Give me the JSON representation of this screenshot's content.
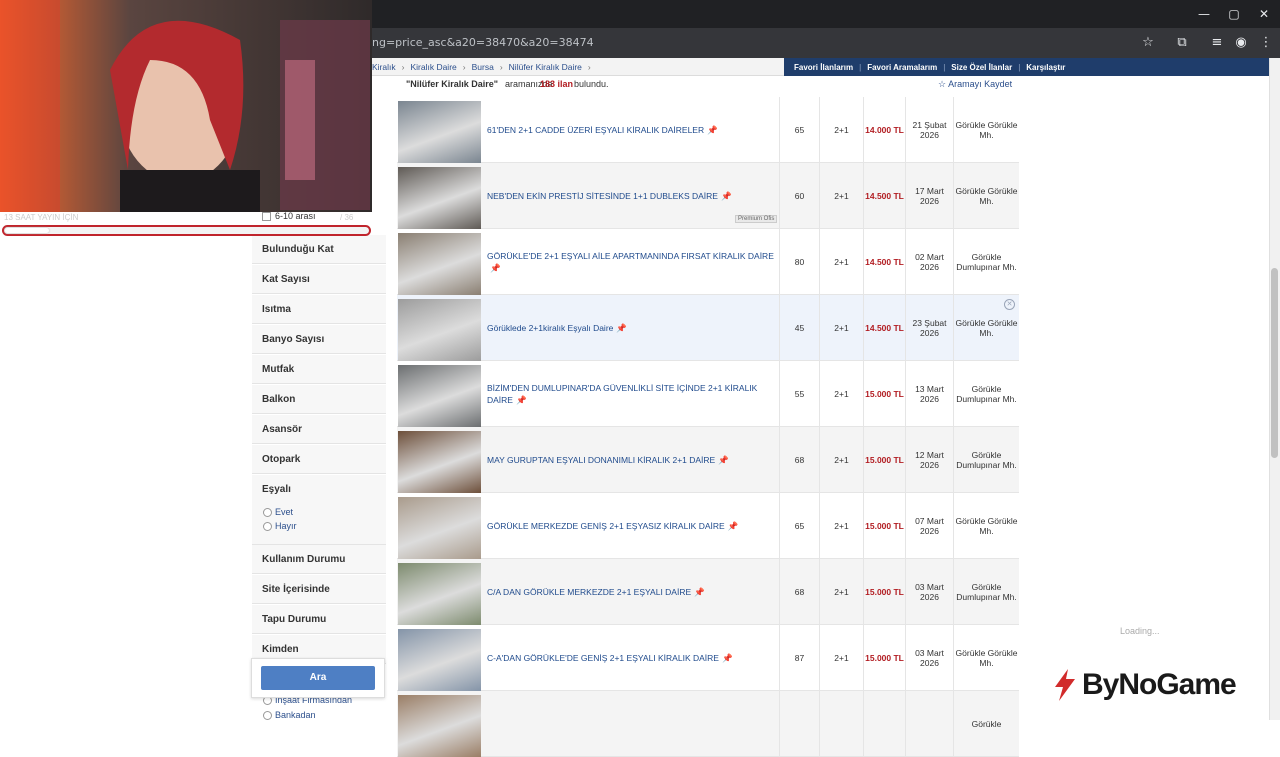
{
  "browser": {
    "url": "ng=price_asc&a20=38470&a20=38474",
    "window_buttons": [
      "—",
      "▢",
      "✕"
    ],
    "toolbar_icons": [
      "star-icon",
      "extensions-icon",
      "media-icon",
      "profile-icon",
      "menu-icon"
    ]
  },
  "breadcrumb": [
    "Kiralık",
    "Kiralık Daire",
    "Bursa",
    "Nilüfer Kiralık Daire"
  ],
  "top_nav": [
    "Favori İlanlarım",
    "Favori Aramalarım",
    "Size Özel İlanlar",
    "Karşılaştır"
  ],
  "results": {
    "query": "\"Nilüfer Kiralık Daire\"",
    "middle": "aramanızda",
    "count": "183 ilan",
    "suffix": "bulundu.",
    "save_label": "Aramayı Kaydet"
  },
  "listings": [
    {
      "title": "61'DEN 2+1 CADDE ÜZERİ EŞYALI KİRALIK DAİRELER",
      "m2": "65",
      "rooms": "2+1",
      "price": "14.000 TL",
      "date": "21 Şubat 2026",
      "location": "Görükle Görükle Mh.",
      "thumb": "#7a8590"
    },
    {
      "title": "NEB'DEN EKİN PRESTİJ SİTESİNDE 1+1 DUBLEKS DAİRE",
      "m2": "60",
      "rooms": "2+1",
      "price": "14.500 TL",
      "date": "17 Mart 2026",
      "location": "Görükle Görükle Mh.",
      "badge": "Premium Ofis",
      "thumb": "#5f5a55"
    },
    {
      "title": "GÖRÜKLE'DE 2+1 EŞYALI AİLE APARTMANINDA FIRSAT KİRALIK DAİRE",
      "m2": "80",
      "rooms": "2+1",
      "price": "14.500 TL",
      "date": "02 Mart 2026",
      "location": "Görükle Dumlupınar Mh.",
      "thumb": "#8a7f72"
    },
    {
      "title": "Görüklede 2+1kiralık Eşyalı Daire",
      "m2": "45",
      "rooms": "2+1",
      "price": "14.500 TL",
      "date": "23 Şubat 2026",
      "location": "Görükle Görükle Mh.",
      "thumb": "#9c9c9c"
    },
    {
      "title": "BİZİM'DEN DUMLUPINAR'DA GÜVENLİKLİ SİTE İÇİNDE 2+1 KİRALIK DAİRE",
      "m2": "55",
      "rooms": "2+1",
      "price": "15.000 TL",
      "date": "13 Mart 2026",
      "location": "Görükle Dumlupınar Mh.",
      "thumb": "#6b6e70"
    },
    {
      "title": "MAY GURUPTAN EŞYALI DONANIMLI KİRALIK 2+1 DAİRE",
      "m2": "68",
      "rooms": "2+1",
      "price": "15.000 TL",
      "date": "12 Mart 2026",
      "location": "Görükle Dumlupınar Mh.",
      "thumb": "#6d4f3a"
    },
    {
      "title": "GÖRÜKLE MERKEZDE GENİŞ 2+1 EŞYASIZ KİRALIK DAİRE",
      "m2": "65",
      "rooms": "2+1",
      "price": "15.000 TL",
      "date": "07 Mart 2026",
      "location": "Görükle Görükle Mh.",
      "thumb": "#a99b8c"
    },
    {
      "title": "C/A DAN GÖRÜKLE MERKEZDE 2+1 EŞYALI DAİRE",
      "m2": "68",
      "rooms": "2+1",
      "price": "15.000 TL",
      "date": "03 Mart 2026",
      "location": "Görükle Dumlupınar Mh.",
      "thumb": "#7d8b6e"
    },
    {
      "title": "C-A'DAN GÖRÜKLE'DE GENİŞ 2+1 EŞYALI KİRALIK DAİRE",
      "m2": "87",
      "rooms": "2+1",
      "price": "15.000 TL",
      "date": "03 Mart 2026",
      "location": "Görükle Görükle Mh.",
      "thumb": "#8494a8"
    },
    {
      "title": "",
      "m2": "",
      "rooms": "",
      "price": "",
      "date": "",
      "location": "Görükle",
      "thumb": "#9a7e66"
    }
  ],
  "sidebar": {
    "filter_6_10": "6-10 arası",
    "sections": [
      "Bulunduğu Kat",
      "Kat Sayısı",
      "Isıtma",
      "Banyo Sayısı",
      "Mutfak",
      "Balkon",
      "Asansör",
      "Otopark",
      "Eşyalı",
      "Kullanım Durumu",
      "Site İçerisinde",
      "Tapu Durumu",
      "Kimden"
    ],
    "esyali_options": [
      "Evet",
      "Hayır"
    ],
    "kimden_options": [
      "İnşaat Firmasından",
      "Bankadan"
    ],
    "search_button": "Ara"
  },
  "stream": {
    "overlay_text": "13 SAAT YAYIN İÇİN",
    "overlay_count": "/ 36",
    "progress": 0.12,
    "brand": "ByNoGame",
    "loading": "Loading..."
  },
  "colors": {
    "accent": "#1f3d6b",
    "price": "#b21d22",
    "link": "#1f4a8c",
    "button": "#4e7fc4",
    "progress_border": "#c0242c"
  }
}
